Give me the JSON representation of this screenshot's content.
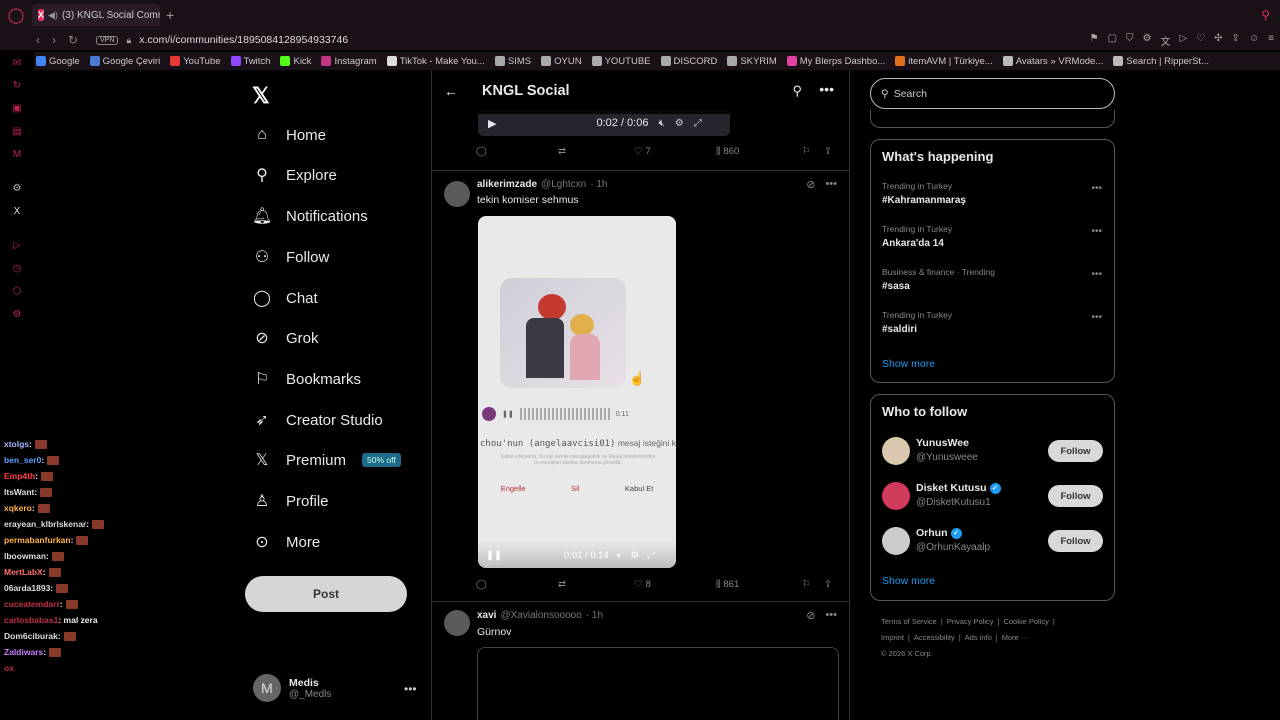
{
  "browser": {
    "tab_title": "(3) KNGL Social Comm",
    "new_tab": "+",
    "vpn": "VPN",
    "url": "x.com/i/communities/1895084128954933746",
    "bookmarks": [
      "Google",
      "Google Çeviri",
      "YouTube",
      "Twitch",
      "Kick",
      "Instagram",
      "TikTok - Make You...",
      "SIMS",
      "OYUN",
      "YOUTUBE",
      "DISCORD",
      "SKYRIM",
      "My Blerps Dashbo...",
      "itemAVM | Türkiye...",
      "Avatars » VRMode...",
      "Search | RipperSt..."
    ]
  },
  "chat": [
    {
      "user": "xtolgs",
      "text": ":",
      "color": "#a8b4ff"
    },
    {
      "user": "ben_ser0",
      "text": ":",
      "color": "#5aa0ff"
    },
    {
      "user": "Emp4th",
      "text": ":",
      "color": "#ff4040"
    },
    {
      "user": "ItsWant",
      "text": ":",
      "color": "#dddddd"
    },
    {
      "user": "xqkero",
      "text": ":",
      "color": "#ffb347"
    },
    {
      "user": "erayean_klbrlskenar",
      "text": ":",
      "color": "#dddddd"
    },
    {
      "user": "permabanfurkan",
      "text": ":",
      "color": "#ffb347"
    },
    {
      "user": "lboowman",
      "text": ":",
      "color": "#dddddd"
    },
    {
      "user": "MertLabX",
      "text": ":",
      "color": "#ff6f6f"
    },
    {
      "user": "06arda1893",
      "text": ":",
      "color": "#dddddd"
    },
    {
      "user": "cuceatemdarr",
      "text": ":",
      "color": "#c0304a"
    },
    {
      "user": "carlosbabas1",
      "text": ": mal zera",
      "color": "#c0304a"
    },
    {
      "user": "Dom6ciburak",
      "text": ":",
      "color": "#dddddd"
    },
    {
      "user": "Zaldiwars",
      "text": ":",
      "color": "#c77dff"
    },
    {
      "user": "ox",
      "text": "",
      "color": "#c0304a"
    }
  ],
  "nav": {
    "home": "Home",
    "explore": "Explore",
    "notifications": "Notifications",
    "follow": "Follow",
    "chat": "Chat",
    "grok": "Grok",
    "bookmarks": "Bookmarks",
    "creator_studio": "Creator Studio",
    "premium": "Premium",
    "premium_badge": "50% off",
    "profile": "Profile",
    "more": "More",
    "post": "Post"
  },
  "account": {
    "initial": "M",
    "name": "Medis",
    "handle": "@_Medls"
  },
  "community": {
    "title": "KNGL Social"
  },
  "prev_tweet": {
    "video_time": "0:02 / 0:06",
    "likes": "7",
    "views": "860"
  },
  "tweet1": {
    "name": "alikerimzade",
    "handle": "@Lghtcxn",
    "time": "· 1h",
    "text": "tekin komiser sehmus",
    "voice_time": "0:11",
    "request_user": "chou'nun (angelaavcisi01)",
    "request_text": "mesaj isteğini kabul et?",
    "request_sub": "Kabul ederseniz, bu kişi sizinle mesajlaşabilir ve Mesaj İsteklerinizden bu mesajları okuma durumunu görebilir.",
    "btn_block": "Engelle",
    "btn_delete": "Sil",
    "btn_accept": "Kabul Et",
    "video_time": "0:01 / 0:14",
    "likes": "8",
    "views": "861"
  },
  "tweet2": {
    "name": "xavi",
    "handle": "@Xavialonsooooo",
    "time": "· 1h",
    "text": "Gürnov"
  },
  "right": {
    "search_placeholder": "Search",
    "whats_happening": "What's happening",
    "trends": [
      {
        "category": "Trending in Turkey",
        "name": "#Kahramanmaraş"
      },
      {
        "category": "Trending in Turkey",
        "name": "Ankara'da 14"
      },
      {
        "category": "Business & finance · Trending",
        "name": "#sasa"
      },
      {
        "category": "Trending in Turkey",
        "name": "#saldiri"
      }
    ],
    "show_more": "Show more",
    "who_to_follow": "Who to follow",
    "suggestions": [
      {
        "name": "YunusWee",
        "handle": "@Yunusweee",
        "verified": false
      },
      {
        "name": "Disket Kutusu",
        "handle": "@DisketKutusu1",
        "verified": true
      },
      {
        "name": "Orhun",
        "handle": "@OrhunKayaalp",
        "verified": true
      }
    ],
    "follow_label": "Follow",
    "footer": [
      "Terms of Service",
      "|",
      "Privacy Policy",
      "|",
      "Cookie Policy",
      "|",
      "Imprint",
      "|",
      "Accessibility",
      "|",
      "Ads info",
      "|",
      "More ···",
      "© 2026 X Corp."
    ]
  }
}
